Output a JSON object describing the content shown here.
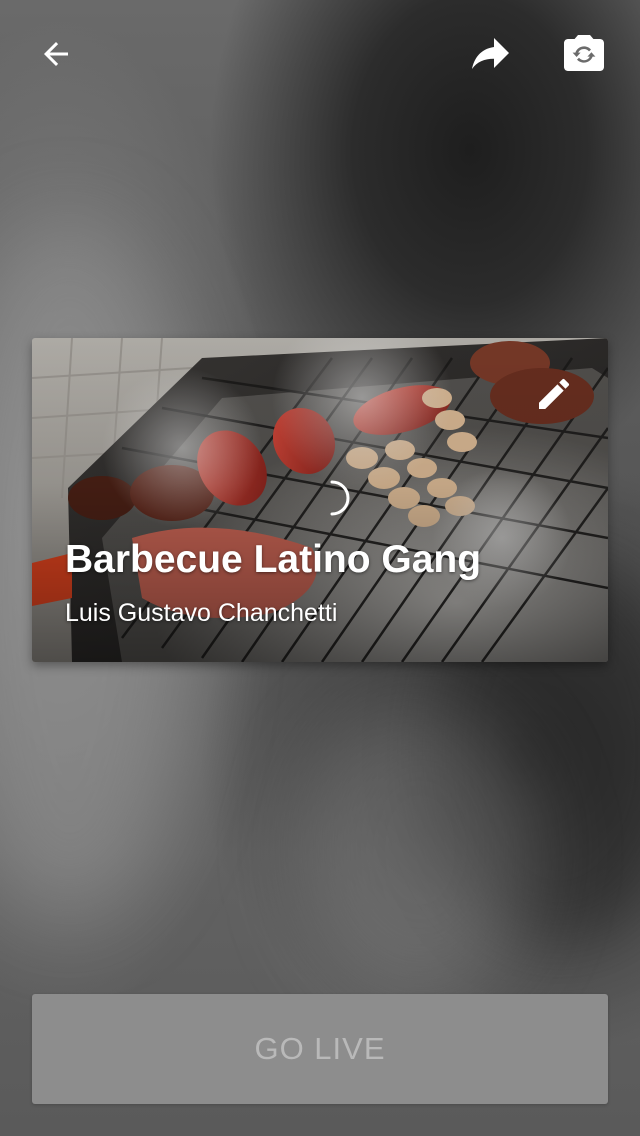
{
  "header": {
    "back_icon": "arrow-left-icon",
    "share_icon": "share-arrow-icon",
    "switch_camera_icon": "camera-switch-icon",
    "icon_color": "#ffffff"
  },
  "card": {
    "title": "Barbecue Latino Gang",
    "subtitle": "Luis Gustavo Chanchetti",
    "edit_icon": "pencil-icon",
    "loading_icon": "loading-spinner-icon",
    "thumbnail": "barbecue-grill-photo"
  },
  "go_live": {
    "label": "GO LIVE",
    "background": "#8d8d8d",
    "text_color": "#b9b9b9"
  }
}
